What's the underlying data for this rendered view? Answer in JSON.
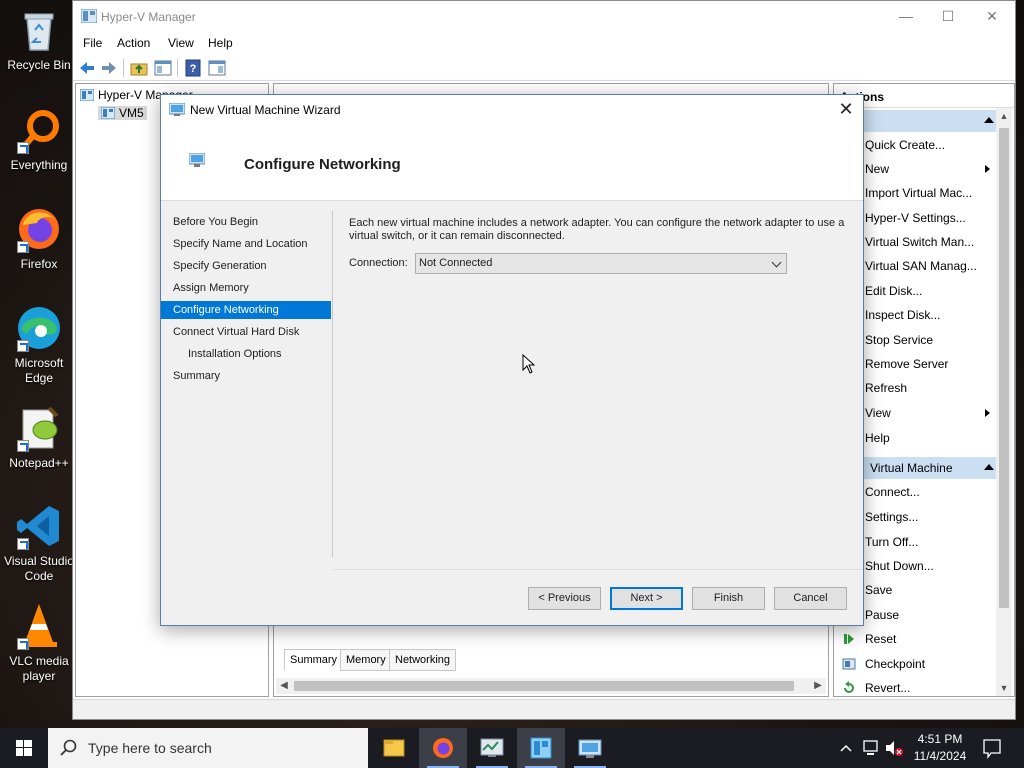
{
  "desktop": {
    "icons": [
      {
        "label": "Recycle Bin",
        "icon": "recycle-bin-icon"
      },
      {
        "label": "Everything",
        "icon": "everything-search-icon"
      },
      {
        "label": "Firefox",
        "icon": "firefox-icon"
      },
      {
        "label": "Microsoft Edge",
        "icon": "edge-icon"
      },
      {
        "label": "Notepad++",
        "icon": "notepadpp-icon"
      },
      {
        "label": "Visual Studio Code",
        "icon": "vscode-icon"
      },
      {
        "label": "VLC media player",
        "icon": "vlc-icon"
      }
    ]
  },
  "hyperv": {
    "title": "Hyper-V Manager",
    "menu": [
      "File",
      "Action",
      "View",
      "Help"
    ],
    "tree": {
      "root": "Hyper-V Manager",
      "child": "VM5"
    },
    "center_tabs": [
      "Summary",
      "Memory",
      "Networking"
    ],
    "actions": {
      "header": "Actions",
      "section1": "",
      "items1": [
        "Quick Create...",
        "New",
        "Import Virtual Mac...",
        "Hyper-V Settings...",
        "Virtual Switch Man...",
        "Virtual SAN Manag...",
        "Edit Disk...",
        "Inspect Disk...",
        "Stop Service",
        "Remove Server",
        "Refresh",
        "View",
        "Help"
      ],
      "section2": "Virtual Machine",
      "items2": [
        "Connect...",
        "Settings...",
        "Turn Off...",
        "Shut Down...",
        "Save",
        "Pause",
        "Reset",
        "Checkpoint",
        "Revert..."
      ]
    }
  },
  "wizard": {
    "title": "New Virtual Machine Wizard",
    "page_title": "Configure Networking",
    "steps": [
      "Before You Begin",
      "Specify Name and Location",
      "Specify Generation",
      "Assign Memory",
      "Configure Networking",
      "Connect Virtual Hard Disk",
      "Installation Options",
      "Summary"
    ],
    "active_step": "Configure Networking",
    "description": "Each new virtual machine includes a network adapter. You can configure the network adapter to use a virtual switch, or it can remain disconnected.",
    "connection_label": "Connection:",
    "connection_value": "Not Connected",
    "buttons": {
      "previous": "< Previous",
      "next": "Next >",
      "finish": "Finish",
      "cancel": "Cancel"
    }
  },
  "taskbar": {
    "search_placeholder": "Type here to search",
    "apps": [
      "file-explorer-icon",
      "firefox-icon",
      "task-manager-icon",
      "hyperv-manager-icon",
      "vmconnect-icon"
    ],
    "time": "4:51 PM",
    "date": "11/4/2024"
  },
  "colors": {
    "accent": "#0078d7",
    "selection_blue": "#cbdff3",
    "taskbar": "#1a1c22"
  }
}
